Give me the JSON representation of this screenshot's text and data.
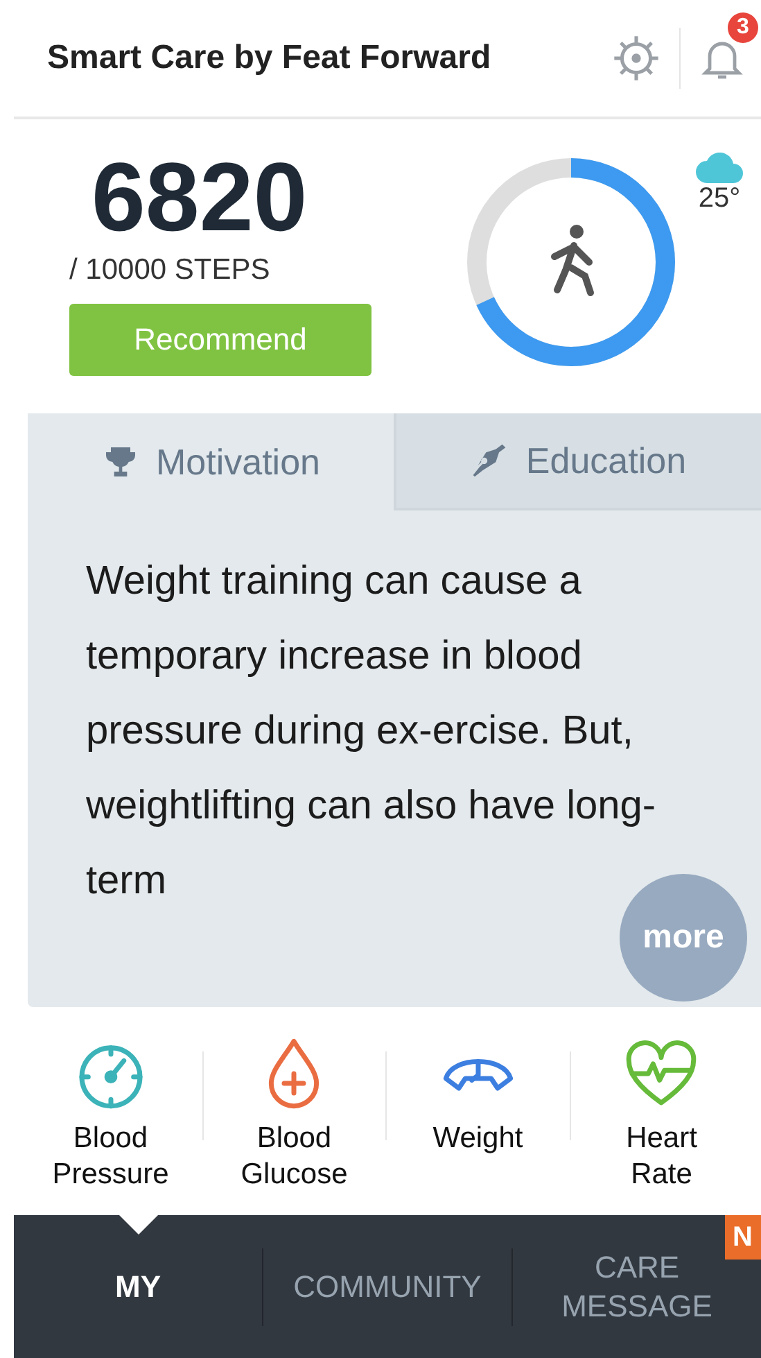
{
  "header": {
    "title": "Smart Care by Feat Forward",
    "notification_count": "3"
  },
  "steps": {
    "count": "6820",
    "goal": "/ 10000 STEPS",
    "button": "Recommend",
    "level": 0.682
  },
  "weather": {
    "temperature": "25°"
  },
  "tabs": [
    {
      "label": "Motivation",
      "kind": "trophy",
      "selected": true
    },
    {
      "label": "Education",
      "kind": "pen",
      "selected": false
    }
  ],
  "tip": {
    "text": "Weight training can cause a temporary increase in blood pressure during ex-ercise. But, weightlifting can also have long-term",
    "more": "more"
  },
  "metrics": [
    {
      "label": "Blood Pressure",
      "kind": "gauge",
      "color": "#3bb3b8"
    },
    {
      "label": "Blood Glucose",
      "kind": "drop",
      "color": "#ea6d42"
    },
    {
      "label": "Weight",
      "kind": "scale",
      "color": "#3d7fe0"
    },
    {
      "label": "Heart Rate",
      "kind": "heart",
      "color": "#66bb3a"
    }
  ],
  "nav": [
    {
      "label": "MY",
      "selected": true
    },
    {
      "label": "COMMUNITY",
      "selected": false
    },
    {
      "label": "CARE MESSAGE",
      "selected": false,
      "badge": "N"
    }
  ]
}
